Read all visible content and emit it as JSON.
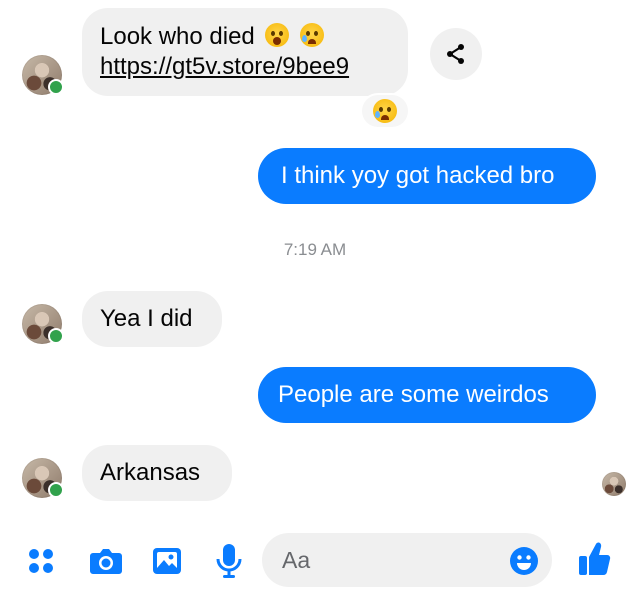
{
  "messages": [
    {
      "line1": "Look who died",
      "link": "https://gt5v.store/9bee9"
    },
    {
      "text": "I think yoy got hacked bro"
    },
    {
      "text": "Yea I did"
    },
    {
      "text": "People are some weirdos"
    },
    {
      "text": "Arkansas"
    }
  ],
  "timestamp": "7:19 AM",
  "composer": {
    "placeholder": "Aa"
  },
  "icons": {
    "share": "share-icon",
    "menu": "four-dots-menu-icon",
    "camera": "camera-icon",
    "gallery": "image-gallery-icon",
    "mic": "microphone-icon",
    "emoji": "smiley-emoji-icon",
    "like": "thumbs-up-icon"
  },
  "colors": {
    "accent": "#0a7cff",
    "incoming": "#f0f0f0",
    "online": "#31a24c"
  }
}
